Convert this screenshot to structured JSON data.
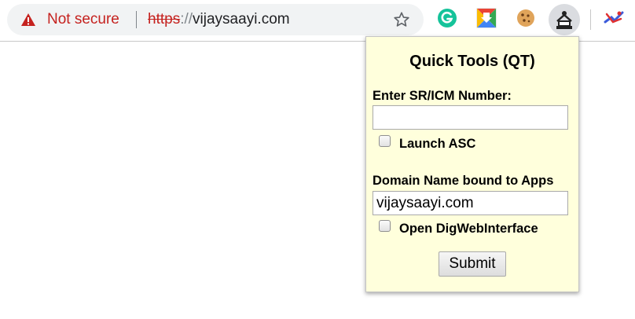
{
  "toolbar": {
    "security_text": "Not secure",
    "url_scheme": "https",
    "url_separator": "://",
    "url_host": "vijaysaayi.com",
    "extensions": [
      "grammarly-icon",
      "drive-icon",
      "cookie-icon",
      "quick-tools-icon",
      "extension-icon"
    ]
  },
  "popup": {
    "title": "Quick Tools (QT)",
    "sr_label": "Enter SR/ICM Number:",
    "sr_value": "",
    "launch_asc_label": "Launch ASC",
    "launch_asc_checked": false,
    "domain_label": "Domain Name bound to Apps",
    "domain_value": "vijaysaayi.com",
    "dig_label": "Open DigWebInterface",
    "dig_checked": false,
    "submit_label": "Submit"
  },
  "colors": {
    "warning_red": "#c5221f",
    "popup_background": "#ffffdc",
    "omnibox_background": "#f1f3f4"
  }
}
